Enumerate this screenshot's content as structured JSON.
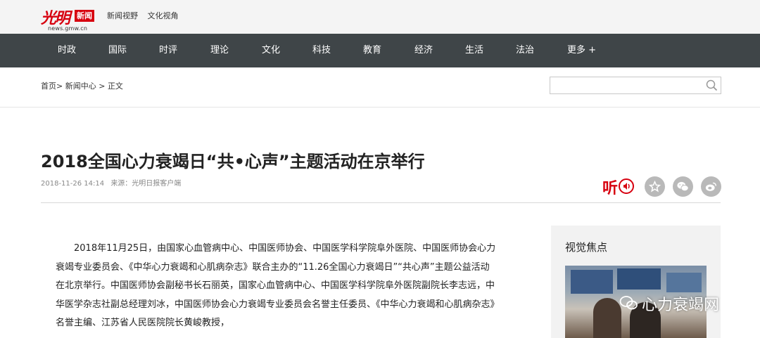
{
  "header": {
    "logo_domain": "news.gmw.cn",
    "logo_box": "新闻",
    "links": [
      "新闻视野",
      "文化视角"
    ]
  },
  "nav": {
    "items": [
      "时政",
      "国际",
      "时评",
      "理论",
      "文化",
      "科技",
      "教育",
      "经济",
      "生活",
      "法治",
      "更多 +"
    ]
  },
  "breadcrumb": {
    "home": "首页",
    "section": "新闻中心",
    "current": "正文",
    "sep": ">"
  },
  "search": {
    "placeholder": "",
    "value": ""
  },
  "article": {
    "title": "2018全国心力衰竭日“共•心声”主题活动在京举行",
    "datetime": "2018-11-26 14:14",
    "source": "来源：光明日报客户端",
    "listen_label": "听",
    "paragraph": "2018年11月25日，由国家心血管病中心、中国医师协会、中国医学科学院阜外医院、中国医师协会心力衰竭专业委员会、《中华心力衰竭和心肌病杂志》联合主办的“11.26全国心力衰竭日”“共心声”主题公益活动在北京举行。中国医师协会副秘书长石丽英，国家心血管病中心、中国医学科学院阜外医院副院长李志远，中华医学杂志社副总经理刘冰，中国医师协会心力衰竭专业委员会名誉主任委员、《中华心力衰竭和心肌病杂志》名誉主编、江苏省人民医院院长黄峻教授，"
  },
  "share_icons": [
    "star-icon",
    "wechat-icon",
    "weibo-icon"
  ],
  "sidebar": {
    "title": "视觉焦点"
  },
  "watermark": {
    "text": "心力衰竭网"
  },
  "colors": {
    "brand_red": "#d7000f",
    "nav_bg": "#3f4548"
  }
}
